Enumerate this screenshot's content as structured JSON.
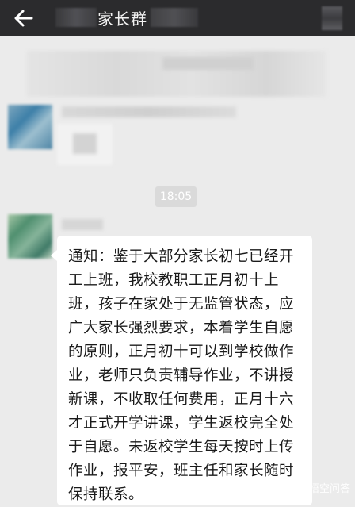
{
  "header": {
    "title": "家长群",
    "back_icon": "arrow-left-icon"
  },
  "timestamp": "18:05",
  "message": {
    "text": "通知：鉴于大部分家长初七已经开工上班，我校教职工正月初十上班，孩子在家处于无监管状态，应广大家长强烈要求，本着学生自愿的原则，正月初十可以到学校做作业，老师只负责辅导作业，不讲授新课，不收取任何费用，正月十六才正式开学讲课，学生返校完全处于自愿。未返校学生每天按时上传作业，报平安，班主任和家长随时保持联系。"
  },
  "watermark": {
    "text": "悟空问答",
    "icon": "wukong-logo-icon"
  },
  "colors": {
    "header_bg": "#2b2b2d",
    "chat_bg": "#ebebeb",
    "bubble_bg": "#ffffff",
    "time_chip_bg": "#dadada"
  }
}
